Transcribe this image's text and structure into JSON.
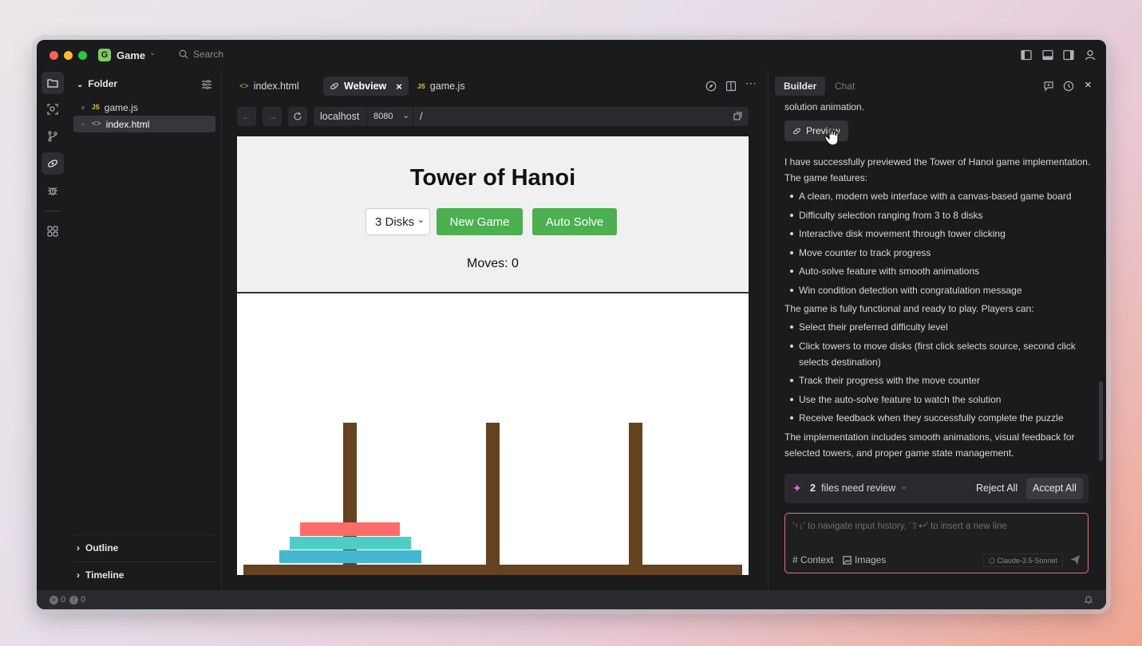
{
  "titlebar": {
    "project_badge": "G",
    "project_name": "Game",
    "search_placeholder": "Search"
  },
  "explorer": {
    "header": "Folder",
    "files": [
      {
        "type": "JS",
        "name": "game.js"
      },
      {
        "type": "<>",
        "name": "index.html"
      }
    ],
    "sections": [
      "Outline",
      "Timeline"
    ]
  },
  "editor": {
    "tabs": [
      {
        "icon": "<>",
        "label": "index.html"
      },
      {
        "icon": "link-icon",
        "label": "Webview"
      },
      {
        "icon": "JS",
        "label": "game.js"
      }
    ],
    "address": {
      "host": "localhost",
      "port": "8080",
      "path": "/"
    }
  },
  "game": {
    "title": "Tower of Hanoi",
    "difficulty": "3 Disks",
    "new_game": "New Game",
    "auto_solve": "Auto Solve",
    "moves": "Moves: 0",
    "disk_colors": [
      "#ff6b6b",
      "#4ecdc4",
      "#45b7d1"
    ],
    "tower_color": "#654321"
  },
  "panel": {
    "tabs": [
      "Builder",
      "Chat"
    ],
    "intro_fragment": "solution animation.",
    "preview_label": "Preview",
    "para1": "I have successfully previewed the Tower of Hanoi game implementation. The game features:",
    "features": [
      "A clean, modern web interface with a canvas-based game board",
      "Difficulty selection ranging from 3 to 8 disks",
      "Interactive disk movement through tower clicking",
      "Move counter to track progress",
      "Auto-solve feature with smooth animations",
      "Win condition detection with congratulation message"
    ],
    "para2": "The game is fully functional and ready to play. Players can:",
    "abilities": [
      "Select their preferred difficulty level",
      "Click towers to move disks (first click selects source, second click selects destination)",
      "Track their progress with the move counter",
      "Use the auto-solve feature to watch the solution",
      "Receive feedback when they successfully complete the puzzle"
    ],
    "para3": "The implementation includes smooth animations, visual feedback for selected towers, and proper game state management.",
    "review": {
      "count": "2",
      "label": "files need review",
      "reject": "Reject All",
      "accept": "Accept All"
    },
    "input_placeholder": "'↑↓' to navigate input history, '⇧↩' to insert a new line",
    "context_label": "Context",
    "images_label": "Images",
    "model": "Claude-3.5-Sonnet"
  },
  "statusbar": {
    "errors": "0",
    "warnings": "0"
  }
}
